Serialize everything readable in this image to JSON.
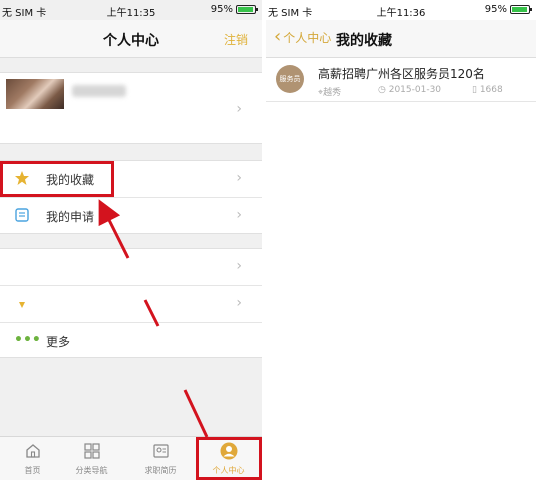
{
  "left_screen": {
    "status": {
      "carrier": "无 SIM 卡 ",
      "time": "上午11:35",
      "battery": "95%"
    },
    "nav": {
      "title": "个人中心",
      "action": "注销"
    },
    "menu": [
      {
        "label": "我的收藏",
        "icon": "star-icon"
      },
      {
        "label": "我的申请",
        "icon": "notebook-icon"
      }
    ],
    "more": {
      "label": "更多"
    },
    "tabs": [
      {
        "label": "首页",
        "icon": "home-icon"
      },
      {
        "label": "分类导航",
        "icon": "grid-icon"
      },
      {
        "label": "求职简历",
        "icon": "resume-icon"
      },
      {
        "label": "个人中心",
        "icon": "user-icon"
      }
    ]
  },
  "right_screen": {
    "status": {
      "carrier": "无 SIM 卡 ",
      "time": "上午11:36",
      "battery": "95%"
    },
    "nav": {
      "back": "个人中心",
      "title": "我的收藏"
    },
    "items": [
      {
        "logo_text": "服务员",
        "title": "高薪招聘广州各区服务员120名",
        "location": "越秀",
        "date": "2015-01-30",
        "views": "1668"
      }
    ]
  },
  "colors": {
    "accent": "#e0b23a",
    "highlight": "#d3131e",
    "battery": "#37c24a"
  }
}
